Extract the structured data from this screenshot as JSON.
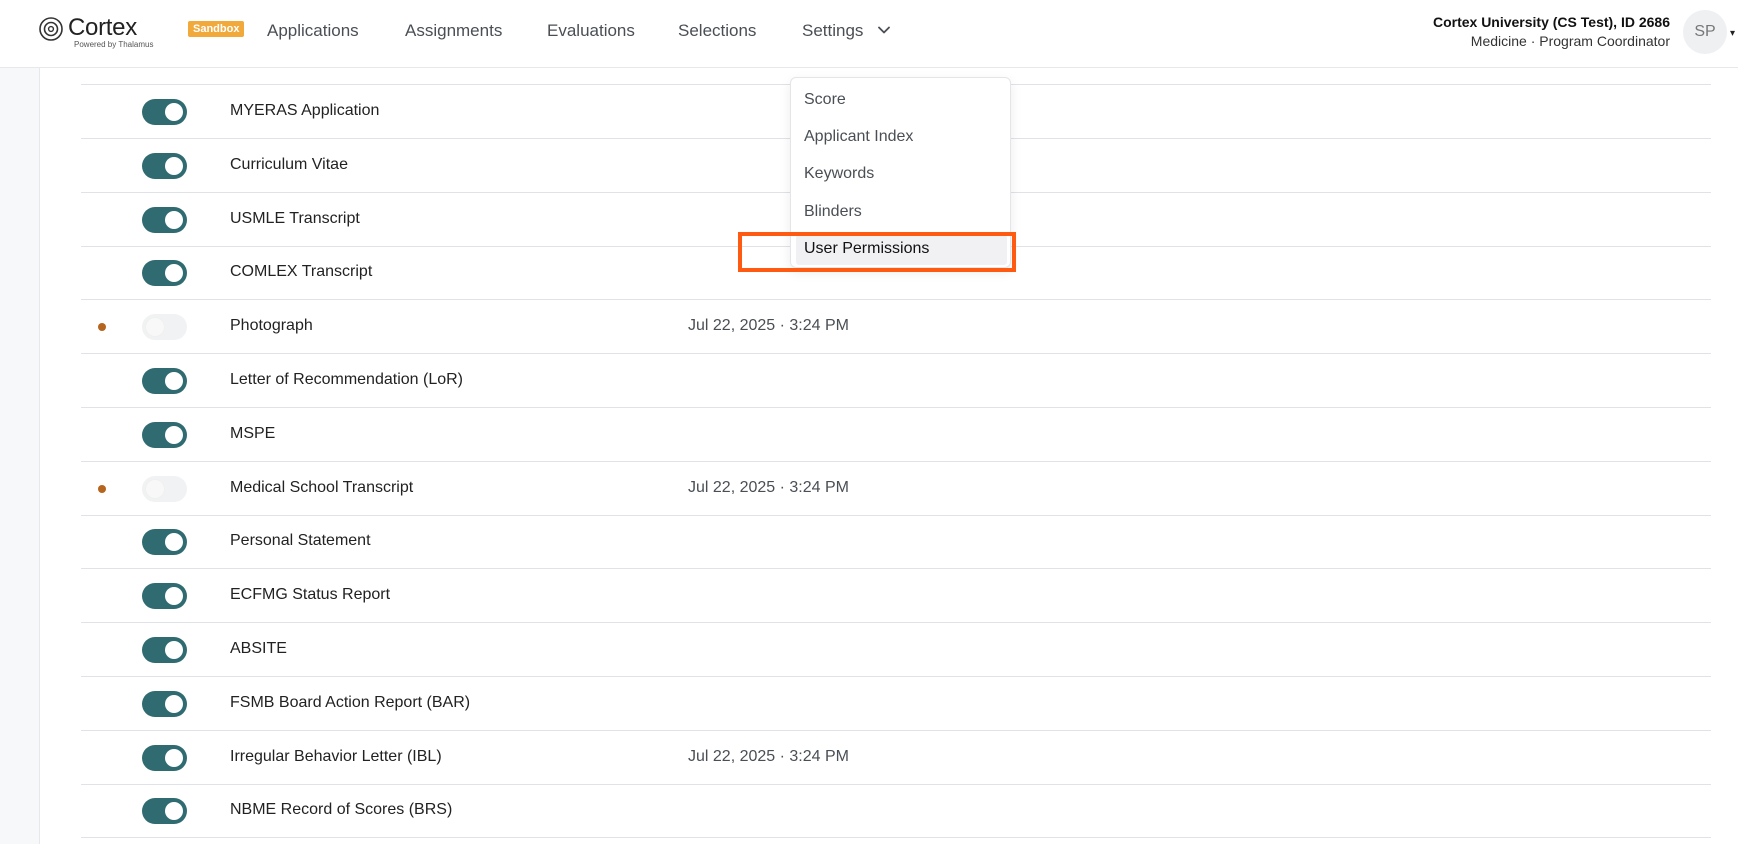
{
  "brand": {
    "name": "Cortex",
    "badge": "Sandbox",
    "tagline": "Powered by Thalamus"
  },
  "nav": {
    "items": [
      "Applications",
      "Assignments",
      "Evaluations",
      "Selections",
      "Settings"
    ]
  },
  "account": {
    "org": "Cortex University (CS Test), ID 2686",
    "role": "Medicine · Program Coordinator",
    "initials": "SP"
  },
  "settings_menu": {
    "items": [
      "Score",
      "Applicant Index",
      "Keywords",
      "Blinders",
      "User Permissions"
    ],
    "active": "User Permissions"
  },
  "documents": [
    {
      "name": "MYERAS Application",
      "enabled": true,
      "flag": false,
      "date": ""
    },
    {
      "name": "Curriculum Vitae",
      "enabled": true,
      "flag": false,
      "date": ""
    },
    {
      "name": "USMLE Transcript",
      "enabled": true,
      "flag": false,
      "date": ""
    },
    {
      "name": "COMLEX Transcript",
      "enabled": true,
      "flag": false,
      "date": ""
    },
    {
      "name": "Photograph",
      "enabled": false,
      "flag": true,
      "date": "Jul 22, 2025 · 3:24 PM"
    },
    {
      "name": "Letter of Recommendation (LoR)",
      "enabled": true,
      "flag": false,
      "date": ""
    },
    {
      "name": "MSPE",
      "enabled": true,
      "flag": false,
      "date": ""
    },
    {
      "name": "Medical School Transcript",
      "enabled": false,
      "flag": true,
      "date": "Jul 22, 2025 · 3:24 PM"
    },
    {
      "name": "Personal Statement",
      "enabled": true,
      "flag": false,
      "date": ""
    },
    {
      "name": "ECFMG Status Report",
      "enabled": true,
      "flag": false,
      "date": ""
    },
    {
      "name": "ABSITE",
      "enabled": true,
      "flag": false,
      "date": ""
    },
    {
      "name": "FSMB Board Action Report (BAR)",
      "enabled": true,
      "flag": false,
      "date": ""
    },
    {
      "name": "Irregular Behavior Letter (IBL)",
      "enabled": true,
      "flag": false,
      "date": "Jul 22, 2025 · 3:24 PM"
    },
    {
      "name": "NBME Record of Scores (BRS)",
      "enabled": true,
      "flag": false,
      "date": ""
    }
  ],
  "colors": {
    "toggle_on": "#2f6b70",
    "flag_dot": "#b5651d",
    "highlight": "#ff5a12",
    "badge": "#f0a93a"
  }
}
